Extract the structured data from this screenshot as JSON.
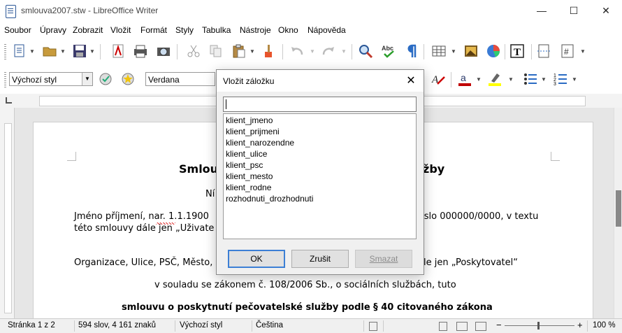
{
  "window": {
    "title": "smlouva2007.stw - LibreOffice Writer",
    "minimize": "—",
    "maximize": "☐",
    "close": "✕"
  },
  "menu": [
    "Soubor",
    "Úpravy",
    "Zobrazit",
    "Vložit",
    "Formát",
    "Styly",
    "Tabulka",
    "Nástroje",
    "Okno",
    "Nápověda"
  ],
  "formatting": {
    "paragraph_style": "Výchozí styl",
    "font_name": "Verdana"
  },
  "document": {
    "heading_left": "Smlou",
    "heading_right": "žby",
    "line_ni": "Ní",
    "p1_left": "Jméno příjmení, nar. 1.1.1900",
    "p1_right": "číslo 000000/0000, v textu",
    "p1_line2": "této smlouvy dále jen „Uživate",
    "p2_left": "Organizace, Ulice, PSČ, Město,",
    "p2_right": "ále jen „Poskytovatel“",
    "p3": "v souladu se zákonem č. 108/2006 Sb., o sociálních službách, tuto",
    "p4": "smlouvu o poskytnutí pečovatelské služby podle § 40 citovaného zákona"
  },
  "statusbar": {
    "page": "Stránka 1 z 2",
    "words": "594 slov, 4 161 znaků",
    "style": "Výchozí styl",
    "language": "Čeština",
    "zoom": "100 %"
  },
  "dialog": {
    "title": "Vložit záložku",
    "input_value": "",
    "bookmarks": [
      "klient_jmeno",
      "klient_prijmeni",
      "klient_narozendne",
      "klient_ulice",
      "klient_psc",
      "klient_mesto",
      "klient_rodne",
      "rozhodnuti_drozhodnuti"
    ],
    "ok": "OK",
    "cancel": "Zrušit",
    "delete": "Smazat"
  },
  "colors": {
    "accent": "#3c7fd5",
    "font_color": "#c00000",
    "highlight": "#ffff00"
  }
}
